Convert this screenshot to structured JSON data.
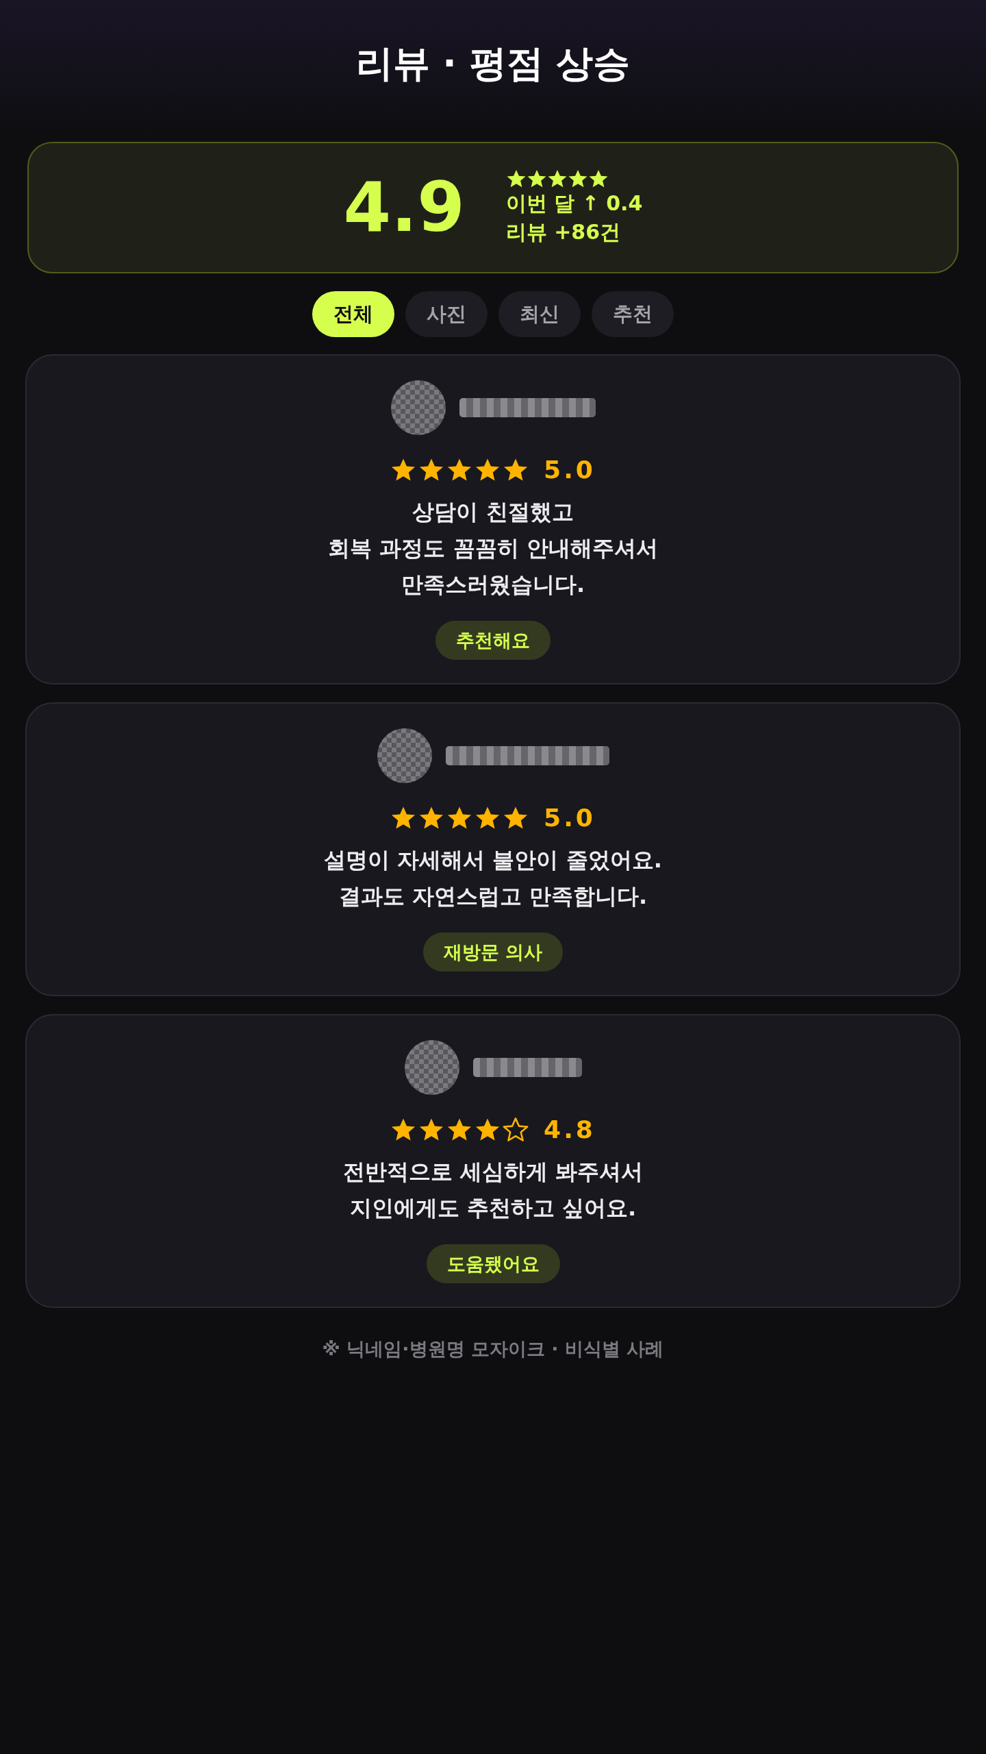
{
  "title": "리뷰 · 평점 상승",
  "summary": {
    "average": "4.9",
    "stars": 5,
    "change": "이번 달 ↑ 0.4",
    "review_count": "리뷰 +86건"
  },
  "tabs": [
    {
      "label": "전체",
      "selected": true
    },
    {
      "label": "사진",
      "selected": false
    },
    {
      "label": "최신",
      "selected": false
    },
    {
      "label": "추천",
      "selected": false
    }
  ],
  "reviews": [
    {
      "stars": 5,
      "rating": "5.0",
      "text": "상담이 친절했고\n회복 과정도 꼼꼼히 안내해주셔서\n만족스러웠습니다.",
      "tag": "추천해요"
    },
    {
      "stars": 5,
      "rating": "5.0",
      "text": "설명이 자세해서 불안이 줄었어요.\n결과도 자연스럽고 만족합니다.",
      "tag": "재방문 의사"
    },
    {
      "stars": 4,
      "rating": "4.8",
      "text": "전반적으로 세심하게 봐주셔서\n지인에게도 추천하고 싶어요.",
      "tag": "도움됐어요"
    }
  ],
  "footer_note": "※ 닉네임·병원명 모자이크 · 비식별 사례"
}
